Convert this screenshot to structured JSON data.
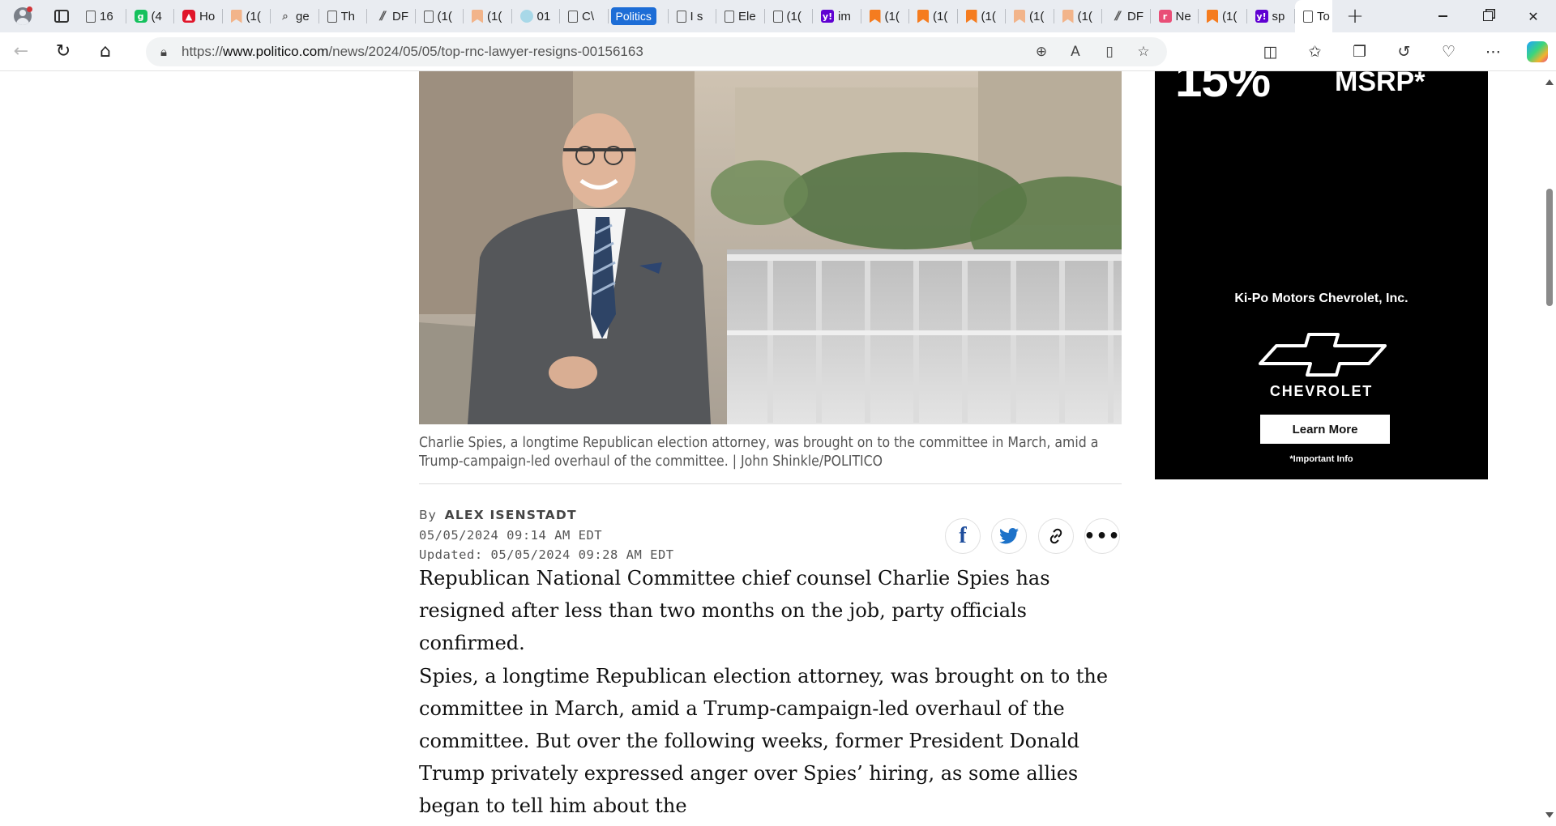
{
  "browser": {
    "tabs": [
      {
        "icon": "doc-icon",
        "title": "16"
      },
      {
        "icon": "grammarly-icon",
        "title": "(4"
      },
      {
        "icon": "red-app-icon",
        "title": "Ho"
      },
      {
        "icon": "bookmark-icon",
        "title": "(1("
      },
      {
        "icon": "search-icon",
        "title": "ge"
      },
      {
        "icon": "doc-icon",
        "title": "Th"
      },
      {
        "icon": "slash-icon",
        "title": "DF"
      },
      {
        "icon": "doc-icon",
        "title": "(1("
      },
      {
        "icon": "bookmark-icon",
        "title": "(1("
      },
      {
        "icon": "chat-icon",
        "title": "01"
      },
      {
        "icon": "doc-icon",
        "title": "C\\"
      },
      {
        "icon": "politics-badge",
        "title": "Politics"
      },
      {
        "icon": "doc-icon",
        "title": "I s"
      },
      {
        "icon": "doc-icon",
        "title": "Ele"
      },
      {
        "icon": "doc-icon",
        "title": "(1("
      },
      {
        "icon": "yahoo-icon",
        "title": "im"
      },
      {
        "icon": "bookmark-icon",
        "title": "(1("
      },
      {
        "icon": "bookmark-icon",
        "title": "(1("
      },
      {
        "icon": "bookmark-icon",
        "title": "(1("
      },
      {
        "icon": "bookmark-icon",
        "title": "(1("
      },
      {
        "icon": "bookmark-icon",
        "title": "(1("
      },
      {
        "icon": "slash-icon",
        "title": "DF"
      },
      {
        "icon": "pink-app-icon",
        "title": "Ne"
      },
      {
        "icon": "bookmark-icon",
        "title": "(1("
      },
      {
        "icon": "yahoo-icon",
        "title": "sp"
      }
    ],
    "active_tab": {
      "title": "To",
      "close": "✕"
    },
    "new_tab": "+",
    "url_prefix": "https://",
    "url_host": "www.politico.com",
    "url_path": "/news/2024/05/05/top-rnc-lawyer-resigns-00156163"
  },
  "article": {
    "caption": "Charlie Spies, a longtime Republican election attorney, was brought on to the committee in March, amid a Trump-campaign-led overhaul of the committee. | John Shinkle/POLITICO",
    "by_label": "By",
    "author": "ALEX ISENSTADT",
    "published": "05/05/2024 09:14 AM EDT",
    "updated": "Updated: 05/05/2024 09:28 AM EDT",
    "share": {
      "facebook": "f",
      "more": "•••"
    },
    "paragraphs": [
      "Republican National Committee chief counsel Charlie Spies has resigned after less than two months on the job, party officials confirmed.",
      "Spies, a longtime Republican election attorney, was brought on to the committee in March, amid a Trump-campaign-led overhaul of the committee. But over the following weeks, former President Donald Trump privately expressed anger over Spies’ hiring, as some allies began to tell him about the"
    ]
  },
  "ad": {
    "headline_partial": "15%",
    "msrp_partial": "MSRP*",
    "dealer": "Ki-Po Motors Chevrolet, Inc.",
    "brand": "CHEVROLET",
    "cta": "Learn More",
    "fine_print": "*Important Info"
  }
}
